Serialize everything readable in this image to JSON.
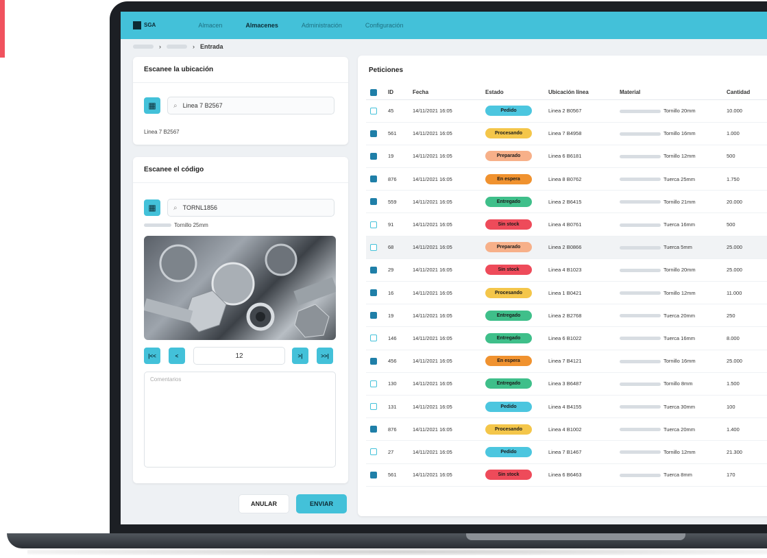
{
  "app": {
    "logo_text": "SGA",
    "nav": [
      "Almacen",
      "Almacenes",
      "Administración",
      "Configuración"
    ]
  },
  "breadcrumb": {
    "current": "Entrada"
  },
  "location_card": {
    "title": "Escanee la ubicación",
    "input_value": "Linea 7 B2567",
    "result": "Linea 7 B2567"
  },
  "code_card": {
    "title": "Escanee el código",
    "input_value": "TORNL1856",
    "material_desc": "Tornillo 25mm",
    "pager": {
      "first": "|<<",
      "prev": "<",
      "page": "12",
      "next": ">|",
      "last": ">>|"
    },
    "textarea_placeholder": "Comentarios"
  },
  "buttons": {
    "cancel": "ANULAR",
    "send": "ENVIAR"
  },
  "table": {
    "title": "Peticiones",
    "headers": [
      "ID",
      "Fecha",
      "Estado",
      "Ubicación línea",
      "Material",
      "Cantidad"
    ],
    "status_colors": {
      "Pedido": "#4cc6df",
      "Procesando": "#f4c64a",
      "Preparado": "#f7b089",
      "En espera": "#f0922f",
      "Entregado": "#3fbf8a",
      "Sin stock": "#ee4b5a"
    },
    "rows": [
      {
        "checked": false,
        "id": "45",
        "date": "14/11/2021 16:05",
        "status": "Pedido",
        "location": "Linea 2 B0567",
        "material": "Tornillo 20mm",
        "qty": "10.000"
      },
      {
        "checked": true,
        "id": "561",
        "date": "14/11/2021 16:05",
        "status": "Procesando",
        "location": "Linea 7 B4958",
        "material": "Tornillo 16mm",
        "qty": "1.000"
      },
      {
        "checked": true,
        "id": "19",
        "date": "14/11/2021 16:05",
        "status": "Preparado",
        "location": "Linea 6 B6181",
        "material": "Tornillo 12mm",
        "qty": "500"
      },
      {
        "checked": true,
        "id": "876",
        "date": "14/11/2021 16:05",
        "status": "En espera",
        "location": "Linea 8 B0762",
        "material": "Tuerca 25mm",
        "qty": "1.750"
      },
      {
        "checked": true,
        "id": "559",
        "date": "14/11/2021 16:05",
        "status": "Entregado",
        "location": "Linea 2 B6415",
        "material": "Tornillo 21mm",
        "qty": "20.000"
      },
      {
        "checked": false,
        "id": "91",
        "date": "14/11/2021 16:05",
        "status": "Sin stock",
        "location": "Linea 4 B0761",
        "material": "Tuerca 16mm",
        "qty": "500"
      },
      {
        "checked": false,
        "id": "68",
        "date": "14/11/2021 16:05",
        "status": "Preparado",
        "location": "Linea 2 B0866",
        "material": "Tuerca 5mm",
        "qty": "25.000"
      },
      {
        "checked": true,
        "id": "29",
        "date": "14/11/2021 16:05",
        "status": "Sin stock",
        "location": "Linea 4 B1023",
        "material": "Tornillo 20mm",
        "qty": "25.000"
      },
      {
        "checked": true,
        "id": "16",
        "date": "14/11/2021 16:05",
        "status": "Procesando",
        "location": "Linea 1 B0421",
        "material": "Tornillo 12mm",
        "qty": "11.000"
      },
      {
        "checked": true,
        "id": "19",
        "date": "14/11/2021 16:05",
        "status": "Entregado",
        "location": "Linea 2 B2768",
        "material": "Tuerca 20mm",
        "qty": "250"
      },
      {
        "checked": false,
        "id": "146",
        "date": "14/11/2021 16:05",
        "status": "Entregado",
        "location": "Linea 6 B1022",
        "material": "Tuerca 16mm",
        "qty": "8.000"
      },
      {
        "checked": true,
        "id": "456",
        "date": "14/11/2021 16:05",
        "status": "En espera",
        "location": "Linea 7 B4121",
        "material": "Tornillo 16mm",
        "qty": "25.000"
      },
      {
        "checked": false,
        "id": "130",
        "date": "14/11/2021 16:05",
        "status": "Entregado",
        "location": "Linea 3 B6487",
        "material": "Tornillo 8mm",
        "qty": "1.500"
      },
      {
        "checked": false,
        "id": "131",
        "date": "14/11/2021 16:05",
        "status": "Pedido",
        "location": "Linea 4 B4155",
        "material": "Tuerca 30mm",
        "qty": "100"
      },
      {
        "checked": true,
        "id": "876",
        "date": "14/11/2021 16:05",
        "status": "Procesando",
        "location": "Linea 4 B1002",
        "material": "Tuerca 20mm",
        "qty": "1.400"
      },
      {
        "checked": false,
        "id": "27",
        "date": "14/11/2021 16:05",
        "status": "Pedido",
        "location": "Linea 7 B1467",
        "material": "Tornillo 12mm",
        "qty": "21.300"
      },
      {
        "checked": true,
        "id": "561",
        "date": "14/11/2021 16:05",
        "status": "Sin stock",
        "location": "Linea 6 B6463",
        "material": "Tuerca 8mm",
        "qty": "170"
      }
    ]
  }
}
